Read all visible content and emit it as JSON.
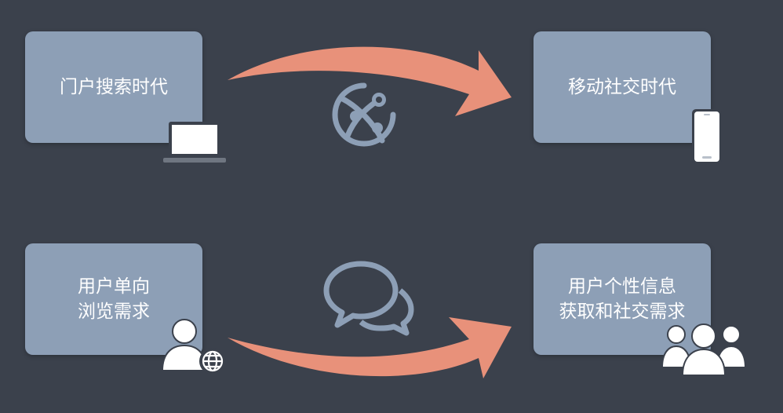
{
  "boxes": {
    "top_left": {
      "label": "门户搜索时代"
    },
    "top_right": {
      "label": "移动社交时代"
    },
    "bottom_left": {
      "line1": "用户单向",
      "line2": "浏览需求"
    },
    "bottom_right": {
      "line1": "用户个性信息",
      "line2": "获取和社交需求"
    }
  },
  "colors": {
    "background": "#3b414c",
    "box": "#8d9fb6",
    "arrow": "#e8917a",
    "icon_white": "#ffffff",
    "icon_gray": "#8d9fb6"
  },
  "icons": {
    "top_left_device": "laptop-icon",
    "top_right_device": "smartphone-icon",
    "middle_top": "globe-network-icon",
    "middle_bottom": "chat-bubbles-icon",
    "bottom_left_user": "user-globe-icon",
    "bottom_right_users": "group-users-icon"
  }
}
